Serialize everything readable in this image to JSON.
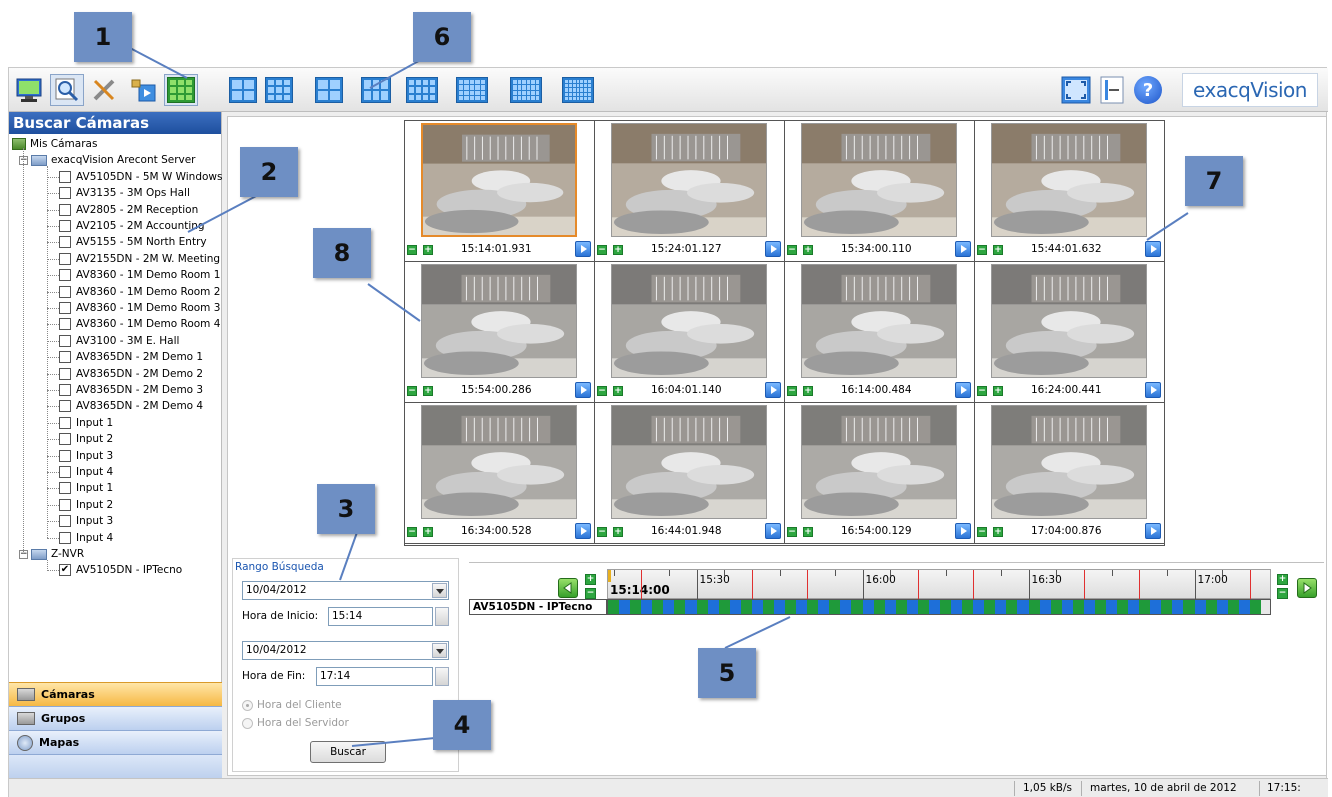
{
  "callouts": [
    "1",
    "2",
    "3",
    "4",
    "5",
    "6",
    "7",
    "8"
  ],
  "toolbar": {
    "left_icons": [
      "live-view-icon",
      "search-icon",
      "configure-icon",
      "export-icon",
      "grid-layout-icon"
    ],
    "layout_icons": [
      "layout-2x2-icon",
      "layout-3x3-icon",
      "layout-2x2-icon",
      "layout-4x3-icon",
      "layout-5x3-icon",
      "layout-5x4-icon",
      "layout-6x4-icon",
      "layout-7x5-icon"
    ],
    "right_icons": [
      "fullscreen-icon",
      "pin-icon",
      "help-icon"
    ],
    "help_glyph": "?",
    "brand": "exacqVision"
  },
  "sidebar": {
    "header": "Buscar Cámaras",
    "root": "Mis Cámaras",
    "servers": [
      {
        "name": "exacqVision Arecont Server",
        "items": [
          {
            "label": "AV5105DN - 5M W Windows",
            "checked": false
          },
          {
            "label": "AV3135 - 3M Ops Hall",
            "checked": false
          },
          {
            "label": "AV2805 - 2M Reception",
            "checked": false
          },
          {
            "label": "AV2105 - 2M Accounting",
            "checked": false
          },
          {
            "label": "AV5155 - 5M North Entry",
            "checked": false
          },
          {
            "label": "AV2155DN - 2M W. Meeting",
            "checked": false
          },
          {
            "label": "AV8360 - 1M Demo Room 1",
            "checked": false
          },
          {
            "label": "AV8360 - 1M Demo Room 2",
            "checked": false
          },
          {
            "label": "AV8360 - 1M Demo Room 3",
            "checked": false
          },
          {
            "label": "AV8360 - 1M Demo Room 4",
            "checked": false
          },
          {
            "label": "AV3100 - 3M E. Hall",
            "checked": false
          },
          {
            "label": "AV8365DN - 2M Demo 1",
            "checked": false
          },
          {
            "label": "AV8365DN - 2M Demo 2",
            "checked": false
          },
          {
            "label": "AV8365DN - 2M Demo 3",
            "checked": false
          },
          {
            "label": "AV8365DN - 2M Demo 4",
            "checked": false
          },
          {
            "label": "Input 1",
            "checked": false
          },
          {
            "label": "Input 2",
            "checked": false
          },
          {
            "label": "Input 3",
            "checked": false
          },
          {
            "label": "Input 4",
            "checked": false
          },
          {
            "label": "Input 1",
            "checked": false
          },
          {
            "label": "Input 2",
            "checked": false
          },
          {
            "label": "Input 3",
            "checked": false
          },
          {
            "label": "Input 4",
            "checked": false
          }
        ]
      },
      {
        "name": "Z-NVR",
        "items": [
          {
            "label": "AV5105DN - IPTecno",
            "checked": true
          }
        ]
      }
    ],
    "checkmark": "✔",
    "collapse_glyph": "−",
    "tabs": [
      {
        "label": "Cámaras",
        "active": true
      },
      {
        "label": "Grupos",
        "active": false
      },
      {
        "label": "Mapas",
        "active": false
      }
    ]
  },
  "thumbnails": [
    "15:14:01.931",
    "15:24:01.127",
    "15:34:00.110",
    "15:44:01.632",
    "15:54:00.286",
    "16:04:01.140",
    "16:14:00.484",
    "16:24:00.441",
    "16:34:00.528",
    "16:44:01.948",
    "16:54:00.129",
    "17:04:00.876"
  ],
  "thumb_buttons": {
    "minus": "−",
    "plus": "+"
  },
  "search": {
    "group_label": "Rango Búsqueda",
    "start_date": "10/04/2012",
    "start_time_label": "Hora de Inicio:",
    "start_time": "15:14",
    "end_date": "10/04/2012",
    "end_time_label": "Hora de Fin:",
    "end_time": "17:14",
    "radio_client": "Hora del Cliente",
    "radio_server": "Hora del Servidor",
    "button": "Buscar"
  },
  "timeline": {
    "current_time": "15:14:00",
    "ticks": [
      "15:30",
      "16:00",
      "16:30",
      "17:00"
    ],
    "camera": "AV5105DN - IPTecno",
    "zoom_in": "+",
    "zoom_out": "−",
    "colors": {
      "track_blue": "#1e6fd9",
      "track_green": "#1f9a3a",
      "marker_red": "#e03030"
    }
  },
  "status": {
    "rate": "1,05 kB/s",
    "date": "martes, 10 de abril de 2012",
    "time": "17:15:"
  }
}
